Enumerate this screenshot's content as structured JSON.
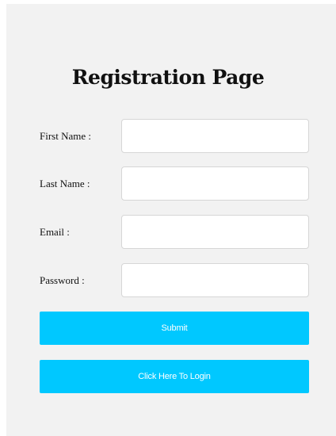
{
  "page": {
    "title": "Registration Page"
  },
  "form": {
    "fields": [
      {
        "label": "First Name :",
        "value": "",
        "placeholder": ""
      },
      {
        "label": "Last Name :",
        "value": "",
        "placeholder": ""
      },
      {
        "label": "Email :",
        "value": "",
        "placeholder": ""
      },
      {
        "label": "Password :",
        "value": "",
        "placeholder": ""
      }
    ],
    "submit_label": "Submit",
    "login_label": "Click Here To Login"
  },
  "colors": {
    "panel_background": "#f2f2f2",
    "button_accent": "#00c8ff",
    "button_text": "#ffffff"
  }
}
